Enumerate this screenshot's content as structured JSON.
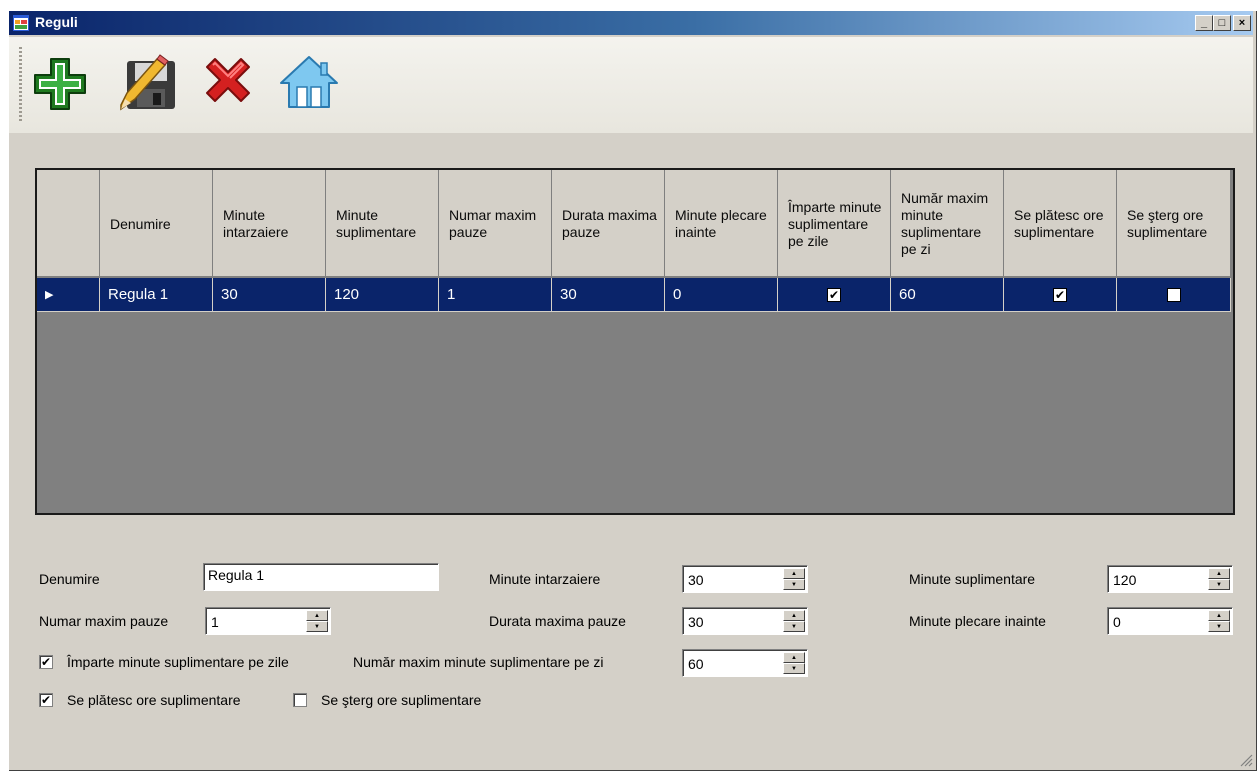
{
  "window": {
    "title": "Reguli",
    "minimize": "_",
    "maximize": "□",
    "close": "×"
  },
  "toolbar": {
    "buttons": [
      {
        "icon": "add-icon"
      },
      {
        "icon": "save-icon"
      },
      {
        "icon": "delete-icon"
      },
      {
        "icon": "home-icon"
      }
    ]
  },
  "grid": {
    "columns": [
      "",
      "Denumire",
      "Minute intarzaiere",
      "Minute suplimentare",
      "Numar maxim pauze",
      "Durata maxima pauze",
      "Minute plecare inainte",
      "Împarte minute suplimentare pe zile",
      "Număr maxim minute suplimentare pe zi",
      "Se plătesc ore suplimentare",
      "Se şterg ore suplimentare"
    ],
    "rows": [
      {
        "indicator": "▶",
        "denumire": "Regula 1",
        "minute_intarzaiere": "30",
        "minute_suplimentare": "120",
        "numar_maxim_pauze": "1",
        "durata_maxima_pauze": "30",
        "minute_plecare_inainte": "0",
        "imparte": true,
        "numar_maxim_minute": "60",
        "se_platesc": true,
        "se_sterg": false
      }
    ]
  },
  "form": {
    "denumire_label": "Denumire",
    "denumire_value": "Regula 1",
    "minute_intarzaiere_label": "Minute intarzaiere",
    "minute_intarzaiere_value": "30",
    "minute_suplimentare_label": "Minute suplimentare",
    "minute_suplimentare_value": "120",
    "numar_maxim_pauze_label": "Numar maxim pauze",
    "numar_maxim_pauze_value": "1",
    "durata_maxima_pauze_label": "Durata maxima pauze",
    "durata_maxima_pauze_value": "30",
    "minute_plecare_inainte_label": "Minute plecare inainte",
    "minute_plecare_inainte_value": "0",
    "imparte_label": "Împarte minute suplimentare pe zile",
    "imparte_checked": true,
    "numar_maxim_minute_label": "Număr maxim minute suplimentare pe zi",
    "numar_maxim_minute_value": "60",
    "se_platesc_label": "Se plătesc ore suplimentare",
    "se_platesc_checked": true,
    "se_sterg_label": "Se şterg ore suplimentare",
    "se_sterg_checked": false,
    "check_glyph": "✔",
    "spin_up": "▲",
    "spin_down": "▼"
  },
  "colors": {
    "selection": "#0a246a",
    "grid_background": "#808080",
    "control_face": "#d4d0c8"
  }
}
